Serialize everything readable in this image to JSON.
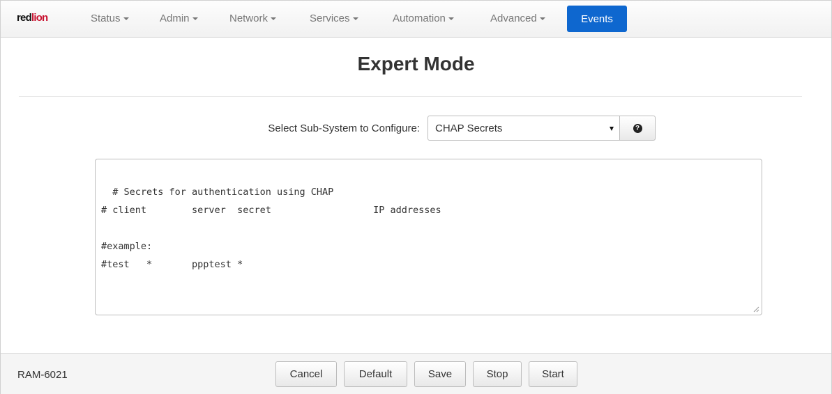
{
  "brand": {
    "logo_text_red": "red",
    "logo_text_dark": "lion"
  },
  "nav": {
    "items": [
      {
        "label": "Status"
      },
      {
        "label": "Admin"
      },
      {
        "label": "Network"
      },
      {
        "label": "Services"
      },
      {
        "label": "Automation"
      },
      {
        "label": "Advanced"
      }
    ],
    "events_label": "Events"
  },
  "page": {
    "title": "Expert Mode"
  },
  "form": {
    "select_label": "Select Sub-System to Configure:",
    "selected_value": "CHAP Secrets",
    "help_icon": "question-circle-icon"
  },
  "editor": {
    "content": "# Secrets for authentication using CHAP\n# client        server  secret                  IP addresses\n\n#example:\n#test   *       ppptest *"
  },
  "footer": {
    "device_name": "RAM-6021",
    "buttons": [
      "Cancel",
      "Default",
      "Save",
      "Stop",
      "Start"
    ]
  },
  "colors": {
    "accent": "#0e67cf",
    "brand_red": "#c8102e"
  }
}
